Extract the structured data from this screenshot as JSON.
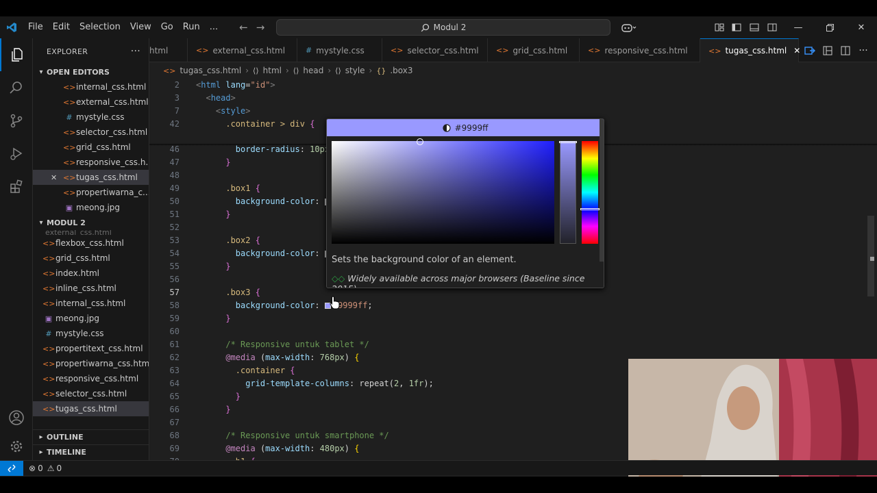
{
  "menu": [
    "File",
    "Edit",
    "Selection",
    "View",
    "Go",
    "Run",
    "..."
  ],
  "search_label": "Modul 2",
  "explorer": {
    "title": "EXPLORER",
    "open_editors_label": "OPEN EDITORS",
    "open_editors": [
      {
        "name": "internal_css.html",
        "type": "html"
      },
      {
        "name": "external_css.html",
        "type": "html"
      },
      {
        "name": "mystyle.css",
        "type": "css"
      },
      {
        "name": "selector_css.html",
        "type": "html"
      },
      {
        "name": "grid_css.html",
        "type": "html"
      },
      {
        "name": "responsive_css.h...",
        "type": "html"
      },
      {
        "name": "tugas_css.html",
        "type": "html"
      },
      {
        "name": "propertiwarna_c...",
        "type": "html"
      },
      {
        "name": "meong.jpg",
        "type": "img"
      }
    ],
    "folder_label": "MODUL 2",
    "folder_cut": "external_css.html",
    "folder_files": [
      {
        "name": "flexbox_css.html",
        "type": "html"
      },
      {
        "name": "grid_css.html",
        "type": "html"
      },
      {
        "name": "index.html",
        "type": "html"
      },
      {
        "name": "inline_css.html",
        "type": "html"
      },
      {
        "name": "internal_css.html",
        "type": "html"
      },
      {
        "name": "meong.jpg",
        "type": "img"
      },
      {
        "name": "mystyle.css",
        "type": "css"
      },
      {
        "name": "propertitext_css.html",
        "type": "html"
      },
      {
        "name": "propertiwarna_css.html",
        "type": "html"
      },
      {
        "name": "responsive_css.html",
        "type": "html"
      },
      {
        "name": "selector_css.html",
        "type": "html"
      },
      {
        "name": "tugas_css.html",
        "type": "html"
      }
    ],
    "outline_label": "OUTLINE",
    "timeline_label": "TIMELINE"
  },
  "tabs": [
    {
      "label": "html",
      "type": "html"
    },
    {
      "label": "external_css.html",
      "type": "html"
    },
    {
      "label": "mystyle.css",
      "type": "css"
    },
    {
      "label": "selector_css.html",
      "type": "html"
    },
    {
      "label": "grid_css.html",
      "type": "html"
    },
    {
      "label": "responsive_css.html",
      "type": "html"
    },
    {
      "label": "tugas_css.html",
      "type": "html"
    }
  ],
  "breadcrumb": [
    "tugas_css.html",
    "html",
    "head",
    "style",
    ".box3"
  ],
  "editor": {
    "sticky": [
      {
        "ln": "2",
        "code": "<html lang=\"id\">"
      },
      {
        "ln": "3",
        "code": "  <head>"
      },
      {
        "ln": "7",
        "code": "    <style>"
      },
      {
        "ln": "42",
        "code": "      .container > div {"
      }
    ],
    "lines": [
      {
        "ln": "46",
        "code": "        border-radius: 10px;"
      },
      {
        "ln": "47",
        "code": "      }"
      },
      {
        "ln": "48",
        "code": ""
      },
      {
        "ln": "49",
        "code": "      .box1 {"
      },
      {
        "ln": "50",
        "code": "        background-color: "
      },
      {
        "ln": "51",
        "code": "      }"
      },
      {
        "ln": "52",
        "code": ""
      },
      {
        "ln": "53",
        "code": "      .box2 {"
      },
      {
        "ln": "54",
        "code": "        background-color: "
      },
      {
        "ln": "55",
        "code": "      }"
      },
      {
        "ln": "56",
        "code": ""
      },
      {
        "ln": "57",
        "code": "      .box3 {"
      },
      {
        "ln": "58",
        "code": "        background-color: #9999ff;"
      },
      {
        "ln": "59",
        "code": "      }"
      },
      {
        "ln": "60",
        "code": ""
      },
      {
        "ln": "61",
        "code": "      /* Responsive untuk tablet */"
      },
      {
        "ln": "62",
        "code": "      @media (max-width: 768px) {"
      },
      {
        "ln": "63",
        "code": "        .container {"
      },
      {
        "ln": "64",
        "code": "          grid-template-columns: repeat(2, 1fr);"
      },
      {
        "ln": "65",
        "code": "        }"
      },
      {
        "ln": "66",
        "code": "      }"
      },
      {
        "ln": "67",
        "code": ""
      },
      {
        "ln": "68",
        "code": "      /* Responsive untuk smartphone */"
      },
      {
        "ln": "69",
        "code": "      @media (max-width: 480px) {"
      },
      {
        "ln": "70",
        "code": "        h1 {"
      }
    ]
  },
  "picker": {
    "value": "#9999ff",
    "color": "#9999ff",
    "description": "Sets the background color of an element.",
    "baseline": "Widely available across major browsers (Baseline since 2015)"
  },
  "status": {
    "errors": "0",
    "warnings": "0"
  },
  "colors": {
    "accent": "#0078d4",
    "picked": "#9999ff"
  }
}
